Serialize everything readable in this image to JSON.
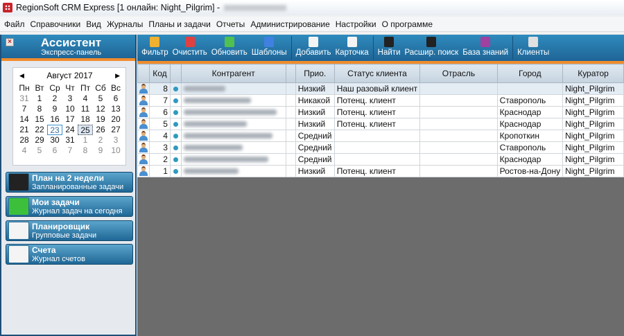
{
  "window": {
    "title": "RegionSoft CRM Express [1 онлайн: Night_Pilgrim] -"
  },
  "menu": [
    "Файл",
    "Справочники",
    "Вид",
    "Журналы",
    "Планы и задачи",
    "Отчеты",
    "Администрирование",
    "Настройки",
    "О программе"
  ],
  "assistant": {
    "title": "Ассистент",
    "subtitle": "Экспресс-панель"
  },
  "calendar": {
    "month": "Август 2017",
    "weekdays": [
      "Пн",
      "Вт",
      "Ср",
      "Чт",
      "Пт",
      "Сб",
      "Вс"
    ],
    "days": [
      "31",
      "1",
      "2",
      "3",
      "4",
      "5",
      "6",
      "7",
      "8",
      "9",
      "10",
      "11",
      "12",
      "13",
      "14",
      "15",
      "16",
      "17",
      "18",
      "19",
      "20",
      "21",
      "22",
      "23",
      "24",
      "25",
      "26",
      "27",
      "28",
      "29",
      "30",
      "31",
      "1",
      "2",
      "3",
      "4",
      "5",
      "6",
      "7",
      "8",
      "9",
      "10"
    ],
    "selected": "23",
    "today": "25"
  },
  "nav": [
    {
      "title": "План на 2 недели",
      "subtitle": "Запланированные задачи",
      "icon": "calendar-grid-icon",
      "color": "#222"
    },
    {
      "title": "Мои задачи",
      "subtitle": "Журнал задач на сегодня",
      "icon": "play-arrow-icon",
      "color": "#3cc03c"
    },
    {
      "title": "Планировщик",
      "subtitle": "Групповые задачи",
      "icon": "document-tree-icon",
      "color": "#f4f4f4"
    },
    {
      "title": "Счета",
      "subtitle": "Журнал счетов",
      "icon": "invoice-icon",
      "color": "#f4f4f4"
    }
  ],
  "toolbar": [
    {
      "label": "Фильтр",
      "icon": "filter-icon",
      "color": "#f0b030"
    },
    {
      "label": "Очистить",
      "icon": "clear-filter-icon",
      "color": "#e04040"
    },
    {
      "label": "Обновить",
      "icon": "refresh-icon",
      "color": "#50c050"
    },
    {
      "label": "Шаблоны",
      "icon": "templates-icon",
      "color": "#4080e0"
    },
    {
      "label": "Добавить",
      "icon": "add-document-icon",
      "color": "#f4f4f4"
    },
    {
      "label": "Карточка",
      "icon": "card-icon",
      "color": "#f4f4f4"
    },
    {
      "label": "Найти",
      "icon": "binoculars-icon",
      "color": "#222"
    },
    {
      "label": "Расшир. поиск",
      "icon": "advanced-search-icon",
      "color": "#222"
    },
    {
      "label": "База знаний",
      "icon": "book-icon",
      "color": "#a040a0"
    },
    {
      "label": "Клиенты",
      "icon": "clients-icon",
      "color": "#e0e0e0"
    }
  ],
  "table": {
    "columns": [
      "",
      "Код",
      "",
      "Контрагент",
      "",
      "Прио.",
      "Статус клиента",
      "Отрасль",
      "Город",
      "Куратор"
    ],
    "rows": [
      {
        "code": "8",
        "prio": "Низкий",
        "status": "Наш разовый клиент",
        "industry": "",
        "city": "",
        "curator": "Night_Pilgrim"
      },
      {
        "code": "7",
        "prio": "Никакой",
        "status": "Потенц. клиент",
        "industry": "",
        "city": "Ставрополь",
        "curator": "Night_Pilgrim"
      },
      {
        "code": "6",
        "prio": "Низкий",
        "status": "Потенц. клиент",
        "industry": "",
        "city": "Краснодар",
        "curator": "Night_Pilgrim"
      },
      {
        "code": "5",
        "prio": "Низкий",
        "status": "Потенц. клиент",
        "industry": "",
        "city": "Краснодар",
        "curator": "Night_Pilgrim"
      },
      {
        "code": "4",
        "prio": "Средний",
        "status": "",
        "industry": "",
        "city": "Кропоткин",
        "curator": "Night_Pilgrim"
      },
      {
        "code": "3",
        "prio": "Средний",
        "status": "",
        "industry": "",
        "city": "Ставрополь",
        "curator": "Night_Pilgrim"
      },
      {
        "code": "2",
        "prio": "Средний",
        "status": "",
        "industry": "",
        "city": "Краснодар",
        "curator": "Night_Pilgrim"
      },
      {
        "code": "1",
        "prio": "Низкий",
        "status": "Потенц. клиент",
        "industry": "",
        "city": "Ростов-на-Дону",
        "curator": "Night_Pilgrim"
      }
    ]
  }
}
